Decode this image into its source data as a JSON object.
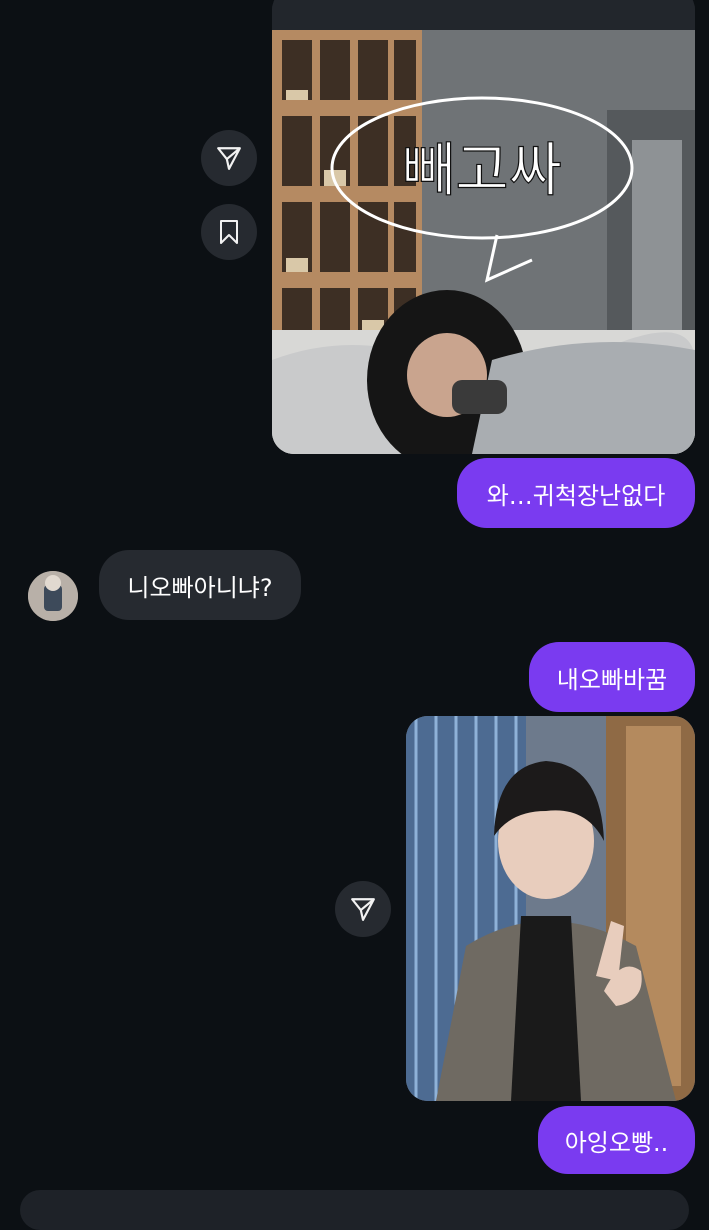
{
  "messages": [
    {
      "id": "m1",
      "side": "me",
      "text": "와…귀척장난없다"
    },
    {
      "id": "m2",
      "side": "them",
      "text": "니오빠아니냐?"
    },
    {
      "id": "m3",
      "side": "me",
      "text": "내오빠바꿈"
    },
    {
      "id": "m4",
      "side": "me",
      "text": "아잉오빵.."
    }
  ],
  "post": {
    "photo_overlay_text": "빼고싸"
  },
  "icons": {
    "share": "send-icon",
    "save": "bookmark-icon"
  },
  "colors": {
    "background": "#0c1014",
    "my_bubble": "#7a3bf0",
    "their_bubble": "#262a30",
    "icon_button": "#262a30"
  }
}
